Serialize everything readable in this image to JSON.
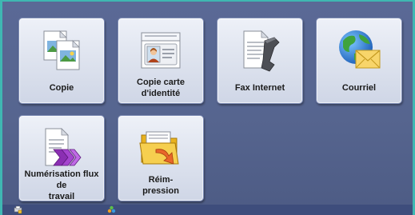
{
  "tiles": [
    {
      "id": "copy",
      "label": "Copie",
      "icon": "copy-icon"
    },
    {
      "id": "id-card-copy",
      "label": "Copie carte\nd'identité",
      "icon": "id-card-icon"
    },
    {
      "id": "internet-fax",
      "label": "Fax Internet",
      "icon": "fax-icon"
    },
    {
      "id": "email",
      "label": "Courriel",
      "icon": "email-globe-icon"
    },
    {
      "id": "workflow-scan",
      "label": "Numérisation flux de\ntravail",
      "icon": "workflow-scan-icon"
    },
    {
      "id": "reprint",
      "label": "Réim-\npression",
      "icon": "reprint-folder-icon"
    }
  ],
  "status_bar": {
    "icons": [
      "printer-lock-icon",
      "network-status-icon"
    ]
  },
  "colors": {
    "frame_accent": "#3fb7b2",
    "background": "#56658f",
    "tile_background": "#e2e7f1"
  }
}
